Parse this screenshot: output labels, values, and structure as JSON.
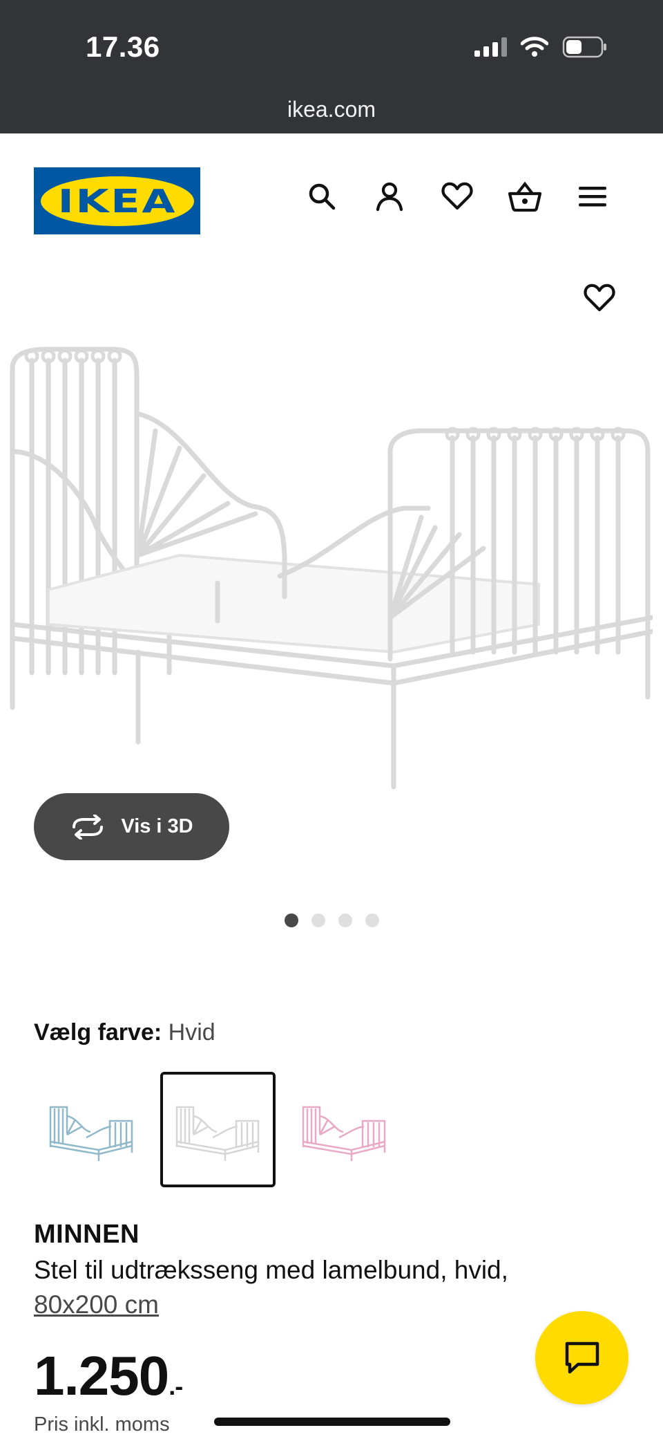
{
  "status_bar": {
    "time": "17.36"
  },
  "browser": {
    "url": "ikea.com"
  },
  "header": {
    "logo_text": "IKEA",
    "icons": [
      "search-icon",
      "account-icon",
      "favourites-icon",
      "basket-icon",
      "menu-icon"
    ]
  },
  "gallery": {
    "vis3d_label": "Vis i 3D",
    "image_count": 4,
    "active_image": 1
  },
  "color_select": {
    "label": "Vælg farve:",
    "value": "Hvid",
    "options": [
      {
        "name": "turquoise",
        "color": "#8fb8c8"
      },
      {
        "name": "white",
        "color": "#e8e8e8",
        "selected": true
      },
      {
        "name": "pink",
        "color": "#e8a8c6"
      }
    ]
  },
  "product": {
    "name": "MINNEN",
    "description": "Stel til udtræksseng med lamelbund, hvid,",
    "size": "80x200 cm",
    "price": "1.250",
    "price_suffix": ".-",
    "price_note": "Pris inkl. moms"
  },
  "colors": {
    "brand_blue": "#0058a3",
    "brand_yellow": "#ffdb00",
    "dark": "#111111"
  }
}
